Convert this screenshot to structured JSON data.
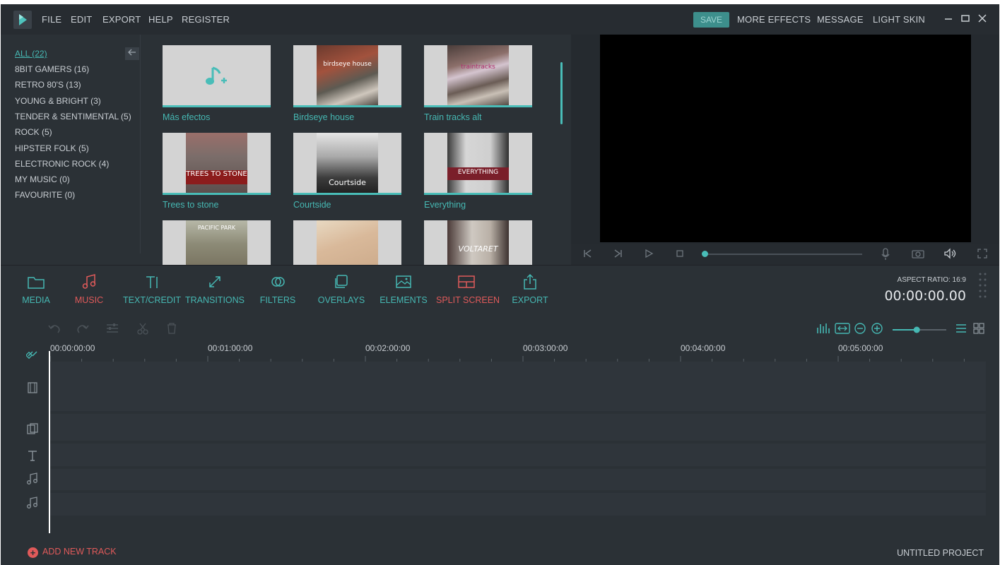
{
  "menu": {
    "items": [
      "FILE",
      "EDIT",
      "EXPORT",
      "HELP",
      "REGISTER"
    ],
    "save": "SAVE",
    "more_effects": "MORE EFFECTS",
    "message": "MESSAGE",
    "light_skin": "LIGHT SKIN"
  },
  "sidebar": {
    "categories": [
      "ALL (22)",
      "8BIT GAMERS (16)",
      "RETRO 80'S (13)",
      "YOUNG & BRIGHT (3)",
      "TENDER & SENTIMENTAL (5)",
      "ROCK (5)",
      "HIPSTER FOLK (5)",
      "ELECTRONIC ROCK (4)",
      "MY MUSIC (0)",
      "FAVOURITE (0)"
    ],
    "active_index": 0
  },
  "grid": {
    "tiles": [
      {
        "label": "Más efectos",
        "art_text": ""
      },
      {
        "label": "Birdseye house",
        "art_text": "birdseye house"
      },
      {
        "label": "Train tracks alt",
        "art_text": "traintracks"
      },
      {
        "label": "Trees to stone",
        "art_text": "TREES TO STONE"
      },
      {
        "label": "Courtside",
        "art_text": "Courtside"
      },
      {
        "label": "Everything",
        "art_text": "EVERYTHING"
      },
      {
        "label": "",
        "art_text": "PACIFIC PARK"
      },
      {
        "label": "",
        "art_text": ""
      },
      {
        "label": "",
        "art_text": "VOLTARET"
      }
    ]
  },
  "toolbar": {
    "tools": [
      {
        "label": "MEDIA",
        "icon": "folder-icon"
      },
      {
        "label": "MUSIC",
        "icon": "music-note-icon"
      },
      {
        "label": "TEXT/CREDIT",
        "icon": "text-icon"
      },
      {
        "label": "TRANSITIONS",
        "icon": "transitions-icon"
      },
      {
        "label": "FILTERS",
        "icon": "filters-icon"
      },
      {
        "label": "OVERLAYS",
        "icon": "overlays-icon"
      },
      {
        "label": "ELEMENTS",
        "icon": "image-icon"
      },
      {
        "label": "SPLIT SCREEN",
        "icon": "split-screen-icon"
      },
      {
        "label": "EXPORT",
        "icon": "export-icon"
      }
    ],
    "aspect_ratio": "ASPECT RATIO: 16:9",
    "timecode": "00:00:00.00"
  },
  "timeline": {
    "ticks": [
      "00:00:00:00",
      "00:01:00:00",
      "00:02:00:00",
      "00:03:00:00",
      "00:04:00:00",
      "00:05:00:00"
    ],
    "add_track": "ADD NEW TRACK",
    "project_name": "UNTITLED PROJECT",
    "zoom_level": 0.45
  },
  "colors": {
    "accent": "#46b8b3",
    "active_tool": "#e05a5a",
    "background": "#2b3136"
  }
}
